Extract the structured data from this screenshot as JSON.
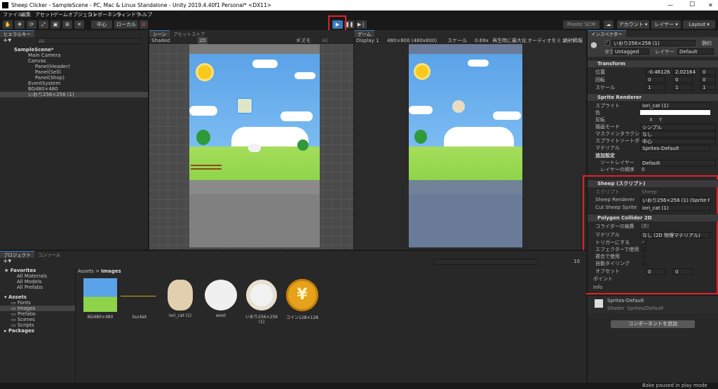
{
  "title": "Sheep Clicker - SampleScene - PC, Mac & Linux Standalone - Unity 2019.4.40f1 Personal* <DX11>",
  "window": {
    "min": "—",
    "max": "☐",
    "close": "✕"
  },
  "menu": [
    "ファイル",
    "編集",
    "アセット",
    "ゲームオブジェクト",
    "コンポーネント",
    "ウィンドウ",
    "ヘルプ"
  ],
  "toolbar": {
    "center": "中心",
    "local": "ローカル",
    "plastic": "Plastic SCM",
    "account": "アカウント",
    "layers": "レイヤー",
    "layout": "Layout"
  },
  "hierarchy": {
    "tab": "ヒエラルキー",
    "search": "All",
    "items": [
      "SampleScene*",
      "Main Camera",
      "Canvas",
      "Panel(Header)",
      "Panel(Sell)",
      "Panel(Shop)",
      "EventSystem",
      "BG480×480",
      "いおり256×256 (1)"
    ]
  },
  "scene": {
    "tab": "シーン",
    "tab2": "アセットストア",
    "shading": "Shaded",
    "mode2d": "2D",
    "gizmos": "ギズモ",
    "search": "All"
  },
  "game": {
    "tab": "ゲーム",
    "display": "Display 1",
    "res": "480×800 (480x800)",
    "scale_label": "スケール",
    "scale": "0.69x",
    "maximize": "再生時に最大化",
    "mute": "オーディオをミュート",
    "stats": "統計情報"
  },
  "inspector": {
    "tab": "インスペクター",
    "static": "静的",
    "name": "いおり256×256 (1)",
    "tag_label": "タグ",
    "tag": "Untagged",
    "layer_label": "レイヤー",
    "layer": "Default",
    "transform": {
      "title": "Transform",
      "pos": "位置",
      "rot": "回転",
      "scale": "スケール",
      "pos_x": "-0.46126",
      "pos_y": "2.02164",
      "pos_z": "0",
      "rot_x": "0",
      "rot_y": "0",
      "rot_z": "0",
      "scl_x": "1",
      "scl_y": "1",
      "scl_z": "1"
    },
    "sprite_renderer": {
      "title": "Sprite Renderer",
      "sprite_label": "スプライト",
      "sprite": "iori_cat (1)",
      "color": "色",
      "flip": "反転",
      "flip_x": "X",
      "flip_y": "Y",
      "draw_mode": "描画モード",
      "draw_val": "シンプル",
      "mask": "マスクインタラクション",
      "mask_val": "なし",
      "pivot": "スプライトソートポイント",
      "pivot_val": "中心",
      "material": "マテリアル",
      "material_val": "Sprites-Default",
      "additional": "追加設定",
      "sorting": "ソートレイヤー",
      "sorting_val": "Default",
      "order": "レイヤーの順序",
      "order_val": "0"
    },
    "sheep": {
      "title": "Sheep (スクリプト)",
      "script_label": "スクリプト",
      "script": "Sheep",
      "renderer_label": "Sheep Renderer",
      "renderer": "いおり256×256 (1) (Sprite Rer",
      "cut_label": "Cut Sheep Sprite",
      "cut": "iori_cat (1)"
    },
    "polygon": {
      "title": "Polygon Collider 2D",
      "edit": "コライダーの編集",
      "material": "マテリアル",
      "material_val": "なし (2D 物理マテリアル)",
      "trigger": "トリガーにする",
      "effector": "エフェクターで使用",
      "composite": "複合で使用",
      "tiling": "自動タイリング",
      "offset": "オフセット",
      "off_x": "0",
      "off_y": "0",
      "points": "ポイント",
      "info": "Info"
    },
    "mat_footer": {
      "name": "Sprites-Default",
      "shader_label": "Shader",
      "shader": "Sprites/Default"
    },
    "add_component": "コンポーネントを追加"
  },
  "project": {
    "tab": "プロジェクト",
    "tab2": "コンソール",
    "favorites": "Favorites",
    "fav_items": [
      "All Materials",
      "All Models",
      "All Prefabs"
    ],
    "assets": "Assets",
    "folders": [
      "Fonts",
      "Images",
      "Prefabs",
      "Scenes",
      "Scripts"
    ],
    "packages": "Packages",
    "breadcrumb_root": "Assets",
    "breadcrumb_cur": "Images",
    "count": "10",
    "assets_list": [
      "BG480×480",
      "bucket",
      "iori_cat (1)",
      "wool",
      "いおり256×256 (1)",
      "コイン128×128"
    ]
  },
  "status": "Bake paused in play mode",
  "colors": {
    "accent": "#3a79bb",
    "highlight_red": "#e0202a",
    "sky": "#5ba3e8",
    "grass": "#8ed44a"
  }
}
